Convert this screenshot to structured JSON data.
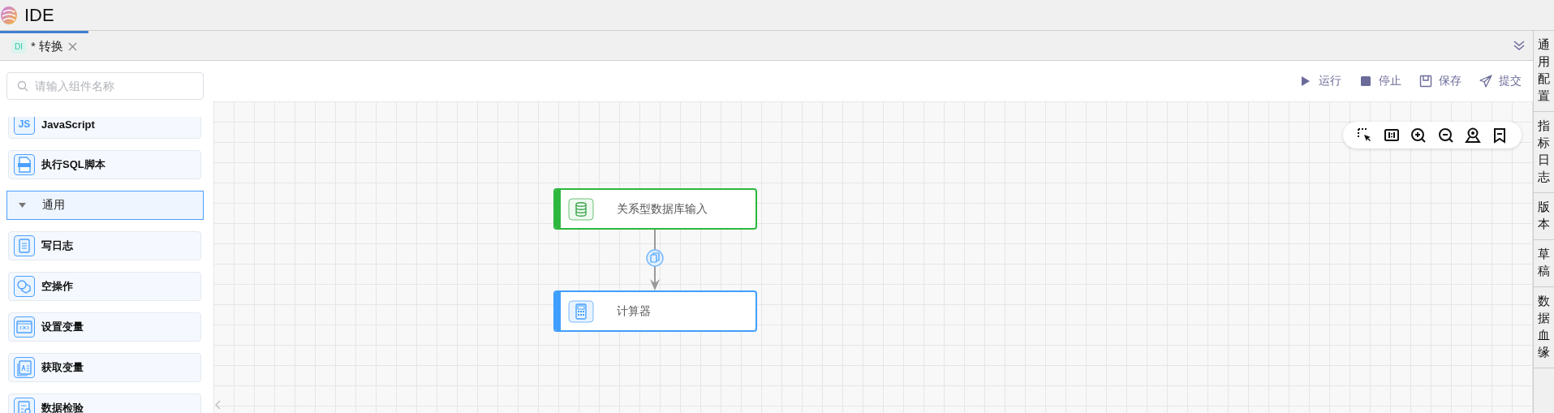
{
  "app": {
    "title": "IDE"
  },
  "tabs": [
    {
      "badge": "DI",
      "label": "* 转换",
      "selected": true
    }
  ],
  "search": {
    "placeholder": "请输入组件名称"
  },
  "palette": [
    {
      "kind": "item",
      "icon_text": "JS",
      "label": "JavaScript"
    },
    {
      "kind": "item",
      "label": "执行SQL脚本"
    },
    {
      "kind": "group",
      "label": "通用",
      "expanded": true
    },
    {
      "kind": "item",
      "label": "写日志"
    },
    {
      "kind": "item",
      "label": "空操作"
    },
    {
      "kind": "item",
      "label": "设置变量"
    },
    {
      "kind": "item",
      "label": "获取变量"
    },
    {
      "kind": "item",
      "label": "数据检验"
    }
  ],
  "toolbar": [
    {
      "label": "运行"
    },
    {
      "label": "停止"
    },
    {
      "label": "保存"
    },
    {
      "label": "提交"
    }
  ],
  "nodes": [
    {
      "label": "关系型数据库输入",
      "color": "#2db73e"
    },
    {
      "label": "计算器",
      "color": "#409eff"
    }
  ],
  "right_panel": [
    "通用配置",
    "指标日志",
    "版本",
    "草稿",
    "数据血缘"
  ]
}
